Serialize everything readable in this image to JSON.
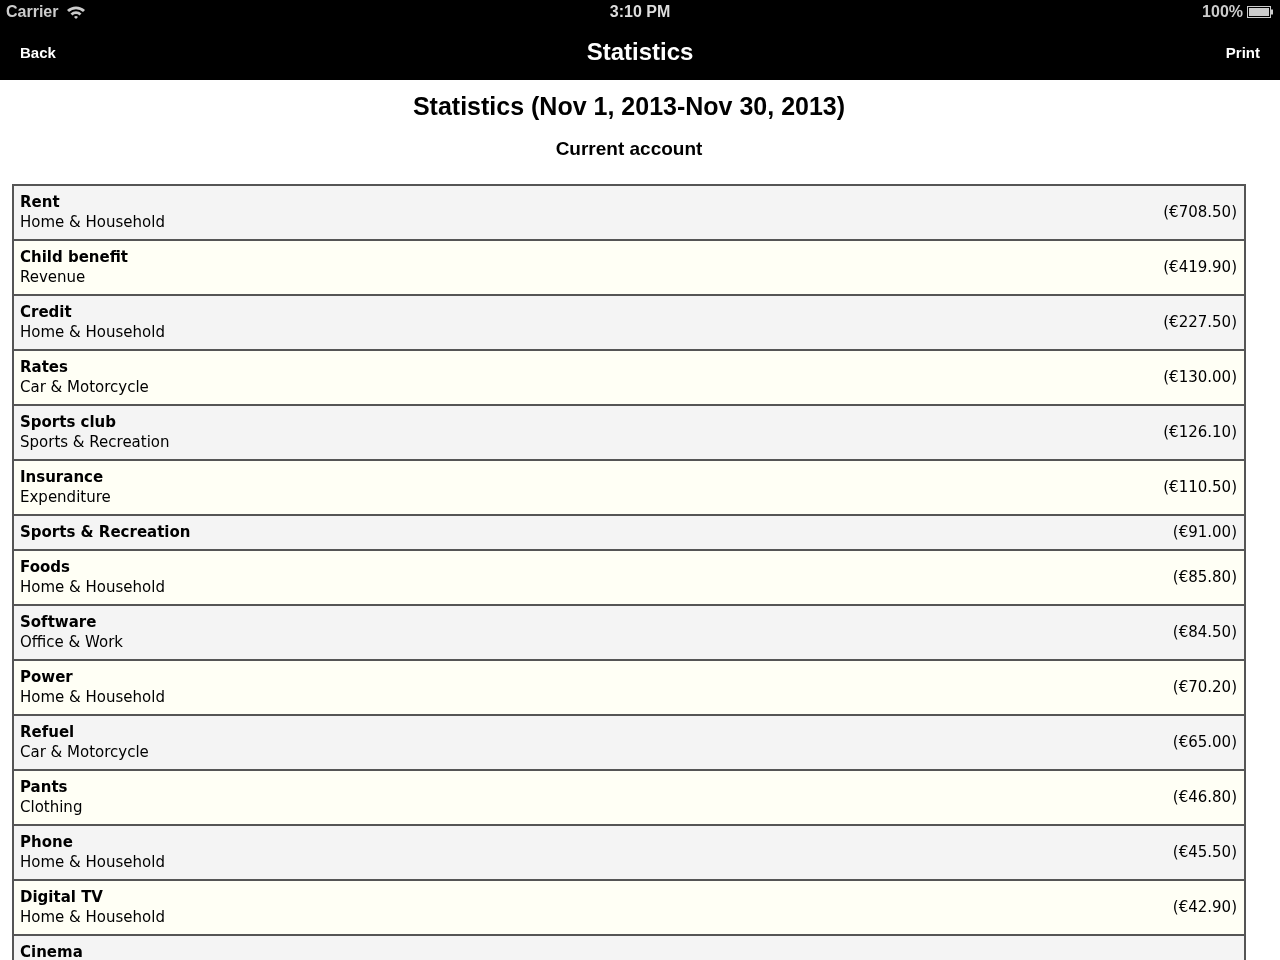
{
  "status_bar": {
    "carrier": "Carrier",
    "time": "3:10 PM",
    "battery": "100%"
  },
  "nav_bar": {
    "back": "Back",
    "title": "Statistics",
    "action": "Print"
  },
  "report": {
    "title": "Statistics (Nov 1, 2013-Nov 30, 2013)",
    "account": "Current account",
    "rows": [
      {
        "name": "Rent",
        "category": "Home & Household",
        "amount": "(€708.50)"
      },
      {
        "name": "Child benefit",
        "category": "Revenue",
        "amount": "(€419.90)"
      },
      {
        "name": "Credit",
        "category": "Home & Household",
        "amount": "(€227.50)"
      },
      {
        "name": "Rates",
        "category": "Car & Motorcycle",
        "amount": "(€130.00)"
      },
      {
        "name": "Sports club",
        "category": "Sports & Recreation",
        "amount": "(€126.10)"
      },
      {
        "name": "Insurance",
        "category": "Expenditure",
        "amount": "(€110.50)"
      },
      {
        "name": "Sports & Recreation",
        "amount": "(€91.00)"
      },
      {
        "name": "Foods",
        "category": "Home & Household",
        "amount": "(€85.80)"
      },
      {
        "name": "Software",
        "category": "Office & Work",
        "amount": "(€84.50)"
      },
      {
        "name": "Power",
        "category": "Home & Household",
        "amount": "(€70.20)"
      },
      {
        "name": "Refuel",
        "category": "Car & Motorcycle",
        "amount": "(€65.00)"
      },
      {
        "name": "Pants",
        "category": "Clothing",
        "amount": "(€46.80)"
      },
      {
        "name": "Phone",
        "category": "Home & Household",
        "amount": "(€45.50)"
      },
      {
        "name": "Digital TV",
        "category": "Home & Household",
        "amount": "(€42.90)"
      },
      {
        "name": "Cinema"
      }
    ]
  }
}
